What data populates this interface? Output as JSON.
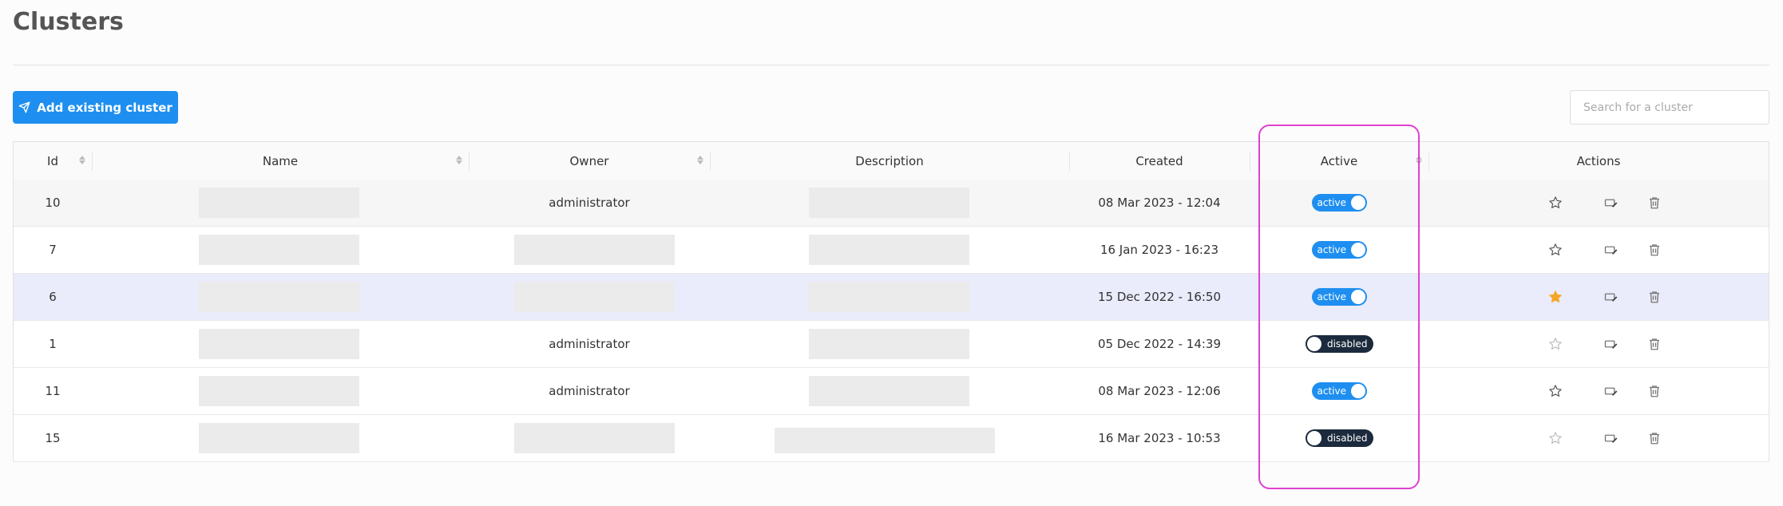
{
  "page": {
    "title": "Clusters"
  },
  "toolbar": {
    "add_label": "Add existing cluster",
    "search_placeholder": "Search for a cluster"
  },
  "table": {
    "columns": {
      "id": "Id",
      "name": "Name",
      "owner": "Owner",
      "description": "Description",
      "created": "Created",
      "active": "Active",
      "actions": "Actions"
    },
    "rows": [
      {
        "id": "10",
        "owner": "administrator",
        "created": "08 Mar 2023 - 12:04",
        "active_label": "active",
        "favorite": false
      },
      {
        "id": "7",
        "owner": "",
        "created": "16 Jan 2023 - 16:23",
        "active_label": "active",
        "favorite": false
      },
      {
        "id": "6",
        "owner": "",
        "created": "15 Dec 2022 - 16:50",
        "active_label": "active",
        "favorite": true
      },
      {
        "id": "1",
        "owner": "administrator",
        "created": "05 Dec 2022 - 14:39",
        "active_label": "disabled",
        "favorite": false
      },
      {
        "id": "11",
        "owner": "administrator",
        "created": "08 Mar 2023 - 12:06",
        "active_label": "active",
        "favorite": false
      },
      {
        "id": "15",
        "owner": "",
        "created": "16 Mar 2023 - 10:53",
        "active_label": "disabled",
        "favorite": false
      }
    ]
  },
  "colors": {
    "accent": "#1e8ff0",
    "disabled_toggle": "#1b2a3c",
    "star_active": "#f5a623",
    "highlight": "#e040d0"
  }
}
